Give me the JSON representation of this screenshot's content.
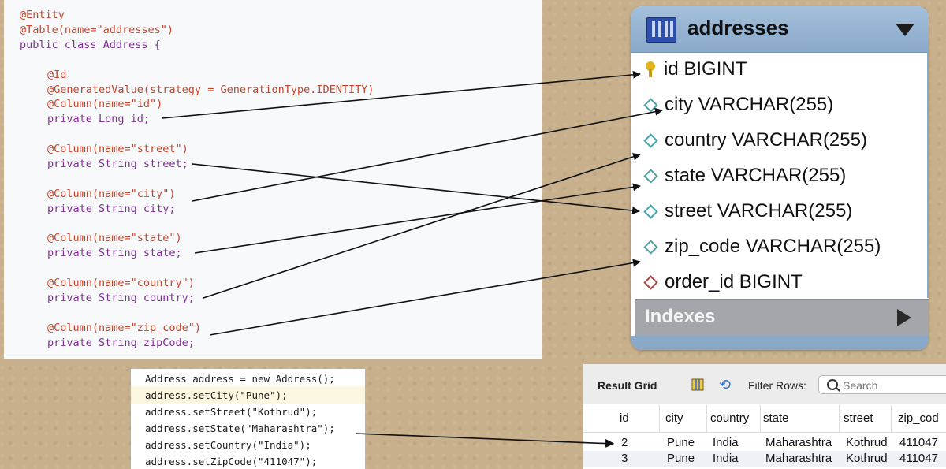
{
  "code": {
    "lines": [
      "@Entity",
      "@Table(name=\"addresses\")",
      "public class Address {",
      "@Id",
      "@GeneratedValue(strategy = GenerationType.IDENTITY)",
      "@Column(name=\"id\")",
      "private Long id;",
      "@Column(name=\"street\")",
      "private String street;",
      "@Column(name=\"city\")",
      "private String city;",
      "@Column(name=\"state\")",
      "private String state;",
      "@Column(name=\"country\")",
      "private String country;",
      "@Column(name=\"zip_code\")",
      "private String zipCode;"
    ]
  },
  "snippet": {
    "lines": [
      "Address address = new Address();",
      "address.setCity(\"Pune\");",
      "address.setStreet(\"Kothrud\");",
      "address.setState(\"Maharashtra\");",
      "address.setCountry(\"India\");",
      "address.setZipCode(\"411047\");"
    ]
  },
  "erd": {
    "title": "addresses",
    "columns": [
      {
        "name": "id BIGINT",
        "icon": "key-icon"
      },
      {
        "name": "city VARCHAR(255)",
        "icon": "column-diamond-icon"
      },
      {
        "name": "country VARCHAR(255)",
        "icon": "column-diamond-icon"
      },
      {
        "name": "state VARCHAR(255)",
        "icon": "column-diamond-icon"
      },
      {
        "name": "street VARCHAR(255)",
        "icon": "column-diamond-icon"
      },
      {
        "name": "zip_code VARCHAR(255)",
        "icon": "column-diamond-icon"
      },
      {
        "name": "order_id BIGINT",
        "icon": "foreign-key-diamond-icon"
      }
    ],
    "indexes_label": "Indexes"
  },
  "grid": {
    "title": "Result Grid",
    "filter_label": "Filter Rows:",
    "search_placeholder": "Search",
    "headers": [
      "id",
      "city",
      "country",
      "state",
      "street",
      "zip_cod"
    ],
    "rows": [
      [
        "2",
        "Pune",
        "India",
        "Maharashtra",
        "Kothrud",
        "411047"
      ],
      [
        "3",
        "Pune",
        "India",
        "Maharashtra",
        "Kothrud",
        "411047"
      ]
    ]
  },
  "colors": {
    "annotation": "#c4452a",
    "keyword": "#7b2f8f",
    "identifier": "#0a4aa3",
    "string": "#1d7a2e",
    "erd_header": "#8aa9c9"
  }
}
